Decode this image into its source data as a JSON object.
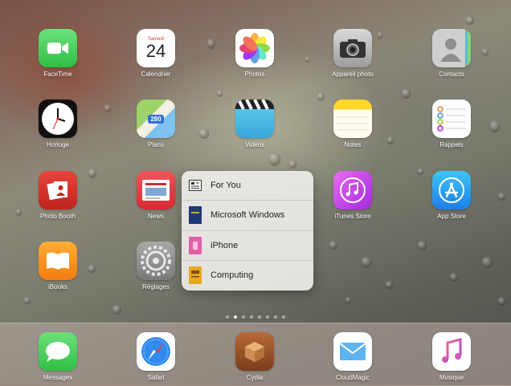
{
  "home_screen": {
    "rows": [
      [
        {
          "name": "FaceTime",
          "label": "FaceTime"
        },
        {
          "name": "Calendrier",
          "label": "Calendrier",
          "day_name": "Samedi",
          "day_number": "24"
        },
        {
          "name": "Photos",
          "label": "Photos"
        },
        {
          "name": "Appareil photo",
          "label": "Appareil photo"
        },
        {
          "name": "Contacts",
          "label": "Contacts"
        }
      ],
      [
        {
          "name": "Horloge",
          "label": "Horloge"
        },
        {
          "name": "Plans",
          "label": "Plans",
          "badge": "280"
        },
        {
          "name": "Vidéos",
          "label": "Vidéos"
        },
        {
          "name": "Notes",
          "label": "Notes"
        },
        {
          "name": "Rappels",
          "label": "Rappels"
        }
      ],
      [
        {
          "name": "Photo Booth",
          "label": "Photo Booth"
        },
        {
          "name": "News",
          "label": "News"
        },
        {
          "name": "",
          "label": ""
        },
        {
          "name": "iTunes Store",
          "label": "iTunes Store"
        },
        {
          "name": "App Store",
          "label": "App Store"
        }
      ],
      [
        {
          "name": "iBooks",
          "label": "iBooks"
        },
        {
          "name": "Réglages",
          "label": "Réglages"
        }
      ]
    ]
  },
  "quick_actions_menu": {
    "items": [
      {
        "label": "For You",
        "icon": "news-article-icon"
      },
      {
        "label": "Microsoft Windows",
        "icon": "blue-book-icon"
      },
      {
        "label": "iPhone",
        "icon": "pink-book-icon"
      },
      {
        "label": "Computing",
        "icon": "yellow-book-icon"
      }
    ]
  },
  "page_indicator": {
    "pages": 8,
    "current": 2
  },
  "dock": {
    "apps": [
      {
        "label": "Messages"
      },
      {
        "label": "Safari"
      },
      {
        "label": "Cydia"
      },
      {
        "label": "CloudMagic"
      },
      {
        "label": "Musique"
      }
    ]
  },
  "colors": {
    "facetime": "#4cd964",
    "menu_bg": "#eeece8",
    "dock_bg": "#bfaea5"
  }
}
